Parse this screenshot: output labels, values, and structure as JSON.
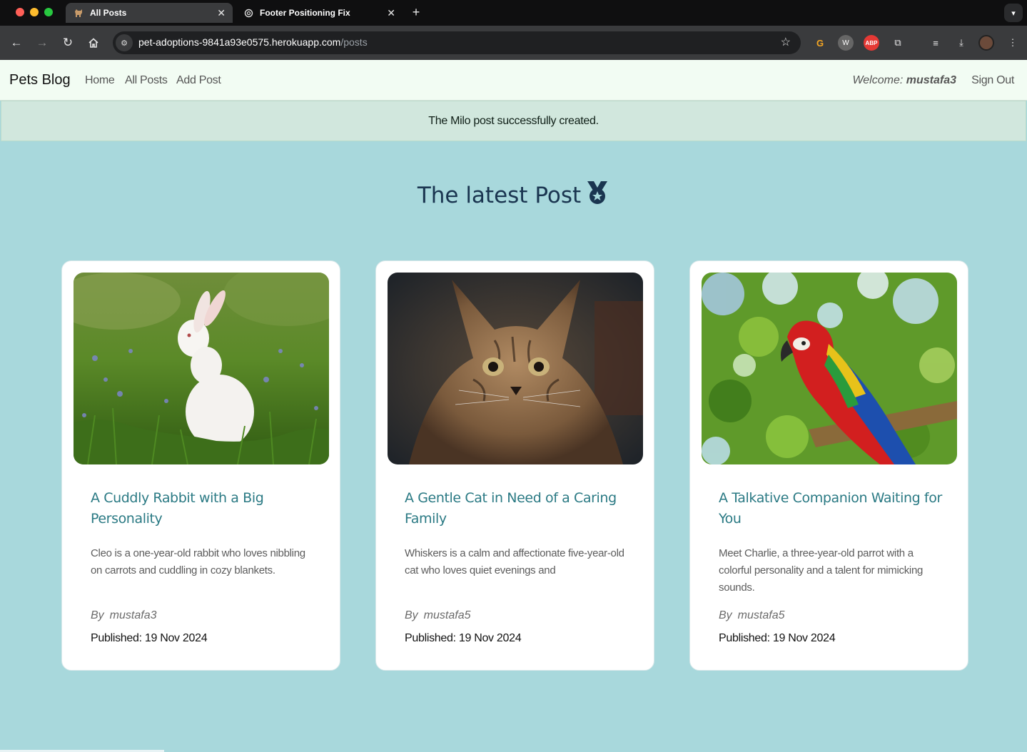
{
  "browser": {
    "tabs": [
      {
        "title": "All Posts",
        "icon": "dog-icon",
        "active": true
      },
      {
        "title": "Footer Positioning Fix",
        "icon": "openai-icon",
        "active": false
      }
    ],
    "url_host": "pet-adoptions-9841a93e0575.herokuapp.com",
    "url_path": "/posts"
  },
  "nav": {
    "brand": "Pets Blog",
    "links": [
      "Home",
      "All Posts",
      "Add Post"
    ],
    "welcome_prefix": "Welcome:",
    "welcome_user": "mustafa3",
    "signout": "Sign Out"
  },
  "alert": {
    "message": "The Milo post successfully created."
  },
  "heading": {
    "title": "The latest Post"
  },
  "posts": [
    {
      "image": "rabbit-photo",
      "title": "A Cuddly Rabbit with a Big Personality",
      "description": "Cleo is a one-year-old rabbit who loves nibbling on carrots and cuddling in cozy blankets.",
      "by": "By",
      "author": "mustafa3",
      "published": "Published: 19 Nov 2024"
    },
    {
      "image": "cat-photo",
      "title": "A Gentle Cat in Need of a Caring Family",
      "description": "Whiskers is a calm and affectionate five-year-old cat who loves quiet evenings and",
      "by": "By",
      "author": "mustafa5",
      "published": "Published: 19 Nov 2024"
    },
    {
      "image": "parrot-photo",
      "title": "A Talkative Companion Waiting for You",
      "description": "Meet Charlie, a three-year-old parrot with a colorful personality and a talent for mimicking sounds.",
      "by": "By",
      "author": "mustafa5",
      "published": "Published: 19 Nov 2024"
    }
  ],
  "colors": {
    "page_bg": "#a8d8dc",
    "navbar_bg": "#f2fcf3",
    "alert_bg": "#d1e7dd",
    "post_title": "#2b7a84",
    "heading": "#1a3550"
  }
}
